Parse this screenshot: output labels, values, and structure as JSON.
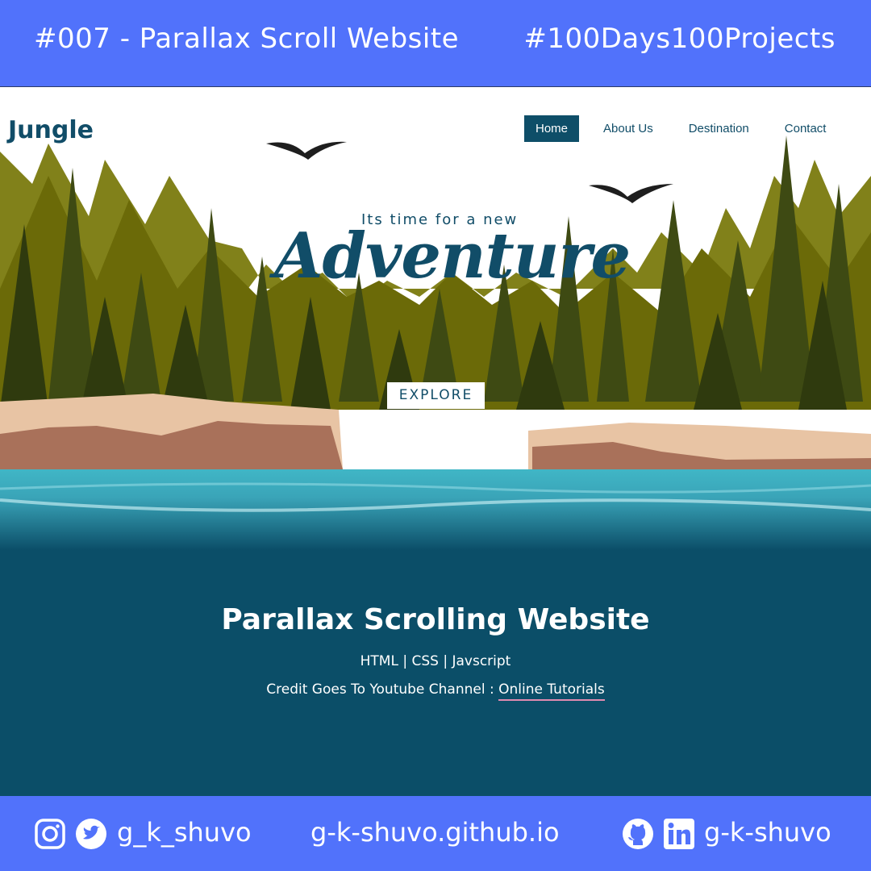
{
  "header": {
    "left": "#007 - Parallax Scroll Website",
    "right": "#100Days100Projects"
  },
  "site": {
    "logo": "Jungle",
    "nav": [
      "Home",
      "About Us",
      "Destination",
      "Contact"
    ],
    "hero_subtitle": "Its time for a new",
    "hero_title": "Adventure",
    "explore_label": "EXPLORE"
  },
  "content": {
    "title": "Parallax Scrolling Website",
    "tech": "HTML | CSS | Javscript",
    "credit_prefix": "Credit Goes To Youtube Channel : ",
    "credit_link": "Online Tutorials"
  },
  "footer": {
    "social_handle": "g_k_shuvo",
    "website": "g-k-shuvo.github.io",
    "dev_handle": "g-k-shuvo"
  },
  "icons": [
    "instagram-icon",
    "twitter-icon",
    "github-icon",
    "linkedin-icon"
  ],
  "colors": {
    "accent": "#5172fb",
    "brand": "#114d68",
    "forest": "#6b6a08",
    "water": "#3fb1c4"
  }
}
